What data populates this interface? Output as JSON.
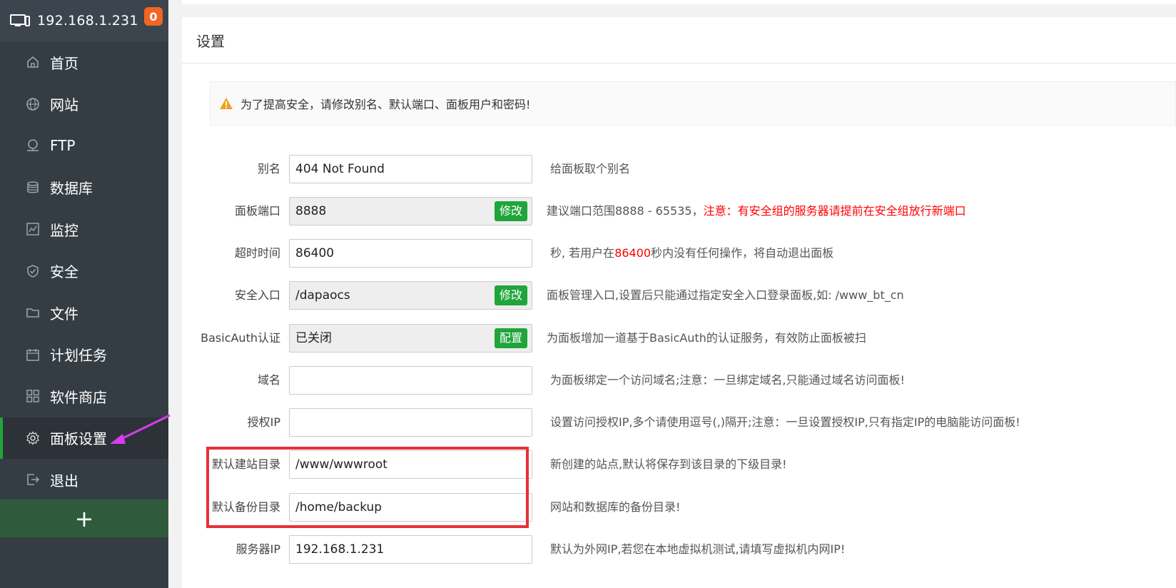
{
  "sidebar": {
    "server_ip": "192.168.1.231",
    "badge_count": "0",
    "items": [
      {
        "label": "首页",
        "icon": "home-icon"
      },
      {
        "label": "网站",
        "icon": "globe-icon"
      },
      {
        "label": "FTP",
        "icon": "ftp-icon"
      },
      {
        "label": "数据库",
        "icon": "database-icon"
      },
      {
        "label": "监控",
        "icon": "monitor-chart-icon"
      },
      {
        "label": "安全",
        "icon": "shield-icon"
      },
      {
        "label": "文件",
        "icon": "folder-icon"
      },
      {
        "label": "计划任务",
        "icon": "calendar-icon"
      },
      {
        "label": "软件商店",
        "icon": "grid-icon"
      },
      {
        "label": "面板设置",
        "icon": "gear-icon",
        "active": true
      },
      {
        "label": "退出",
        "icon": "logout-icon"
      }
    ],
    "add_label": "+"
  },
  "main": {
    "title": "设置",
    "alert": "为了提高安全，请修改别名、默认端口、面板用户和密码!",
    "fields": {
      "alias": {
        "label": "别名",
        "value": "404 Not Found",
        "desc": "给面板取个别名"
      },
      "port": {
        "label": "面板端口",
        "value": "8888",
        "button": "修改",
        "desc": "建议端口范围8888 - 65535，",
        "desc_warn": "注意：有安全组的服务器请提前在安全组放行新端口"
      },
      "timeout": {
        "label": "超时时间",
        "value": "86400",
        "desc_pre": "秒, 若用户在",
        "desc_num": "86400",
        "desc_post": "秒内没有任何操作，将自动退出面板"
      },
      "entry": {
        "label": "安全入口",
        "value": "/dapaocs",
        "button": "修改",
        "desc": "面板管理入口,设置后只能通过指定安全入口登录面板,如: /www_bt_cn"
      },
      "basicauth": {
        "label": "BasicAuth认证",
        "value": "已关闭",
        "button": "配置",
        "desc": "为面板增加一道基于BasicAuth的认证服务，有效防止面板被扫"
      },
      "domain": {
        "label": "域名",
        "value": "",
        "desc": "为面板绑定一个访问域名;注意：一旦绑定域名,只能通过域名访问面板!"
      },
      "auth_ip": {
        "label": "授权IP",
        "value": "",
        "desc": "设置访问授权IP,多个请使用逗号(,)隔开;注意：一旦设置授权IP,只有指定IP的电脑能访问面板!"
      },
      "site_dir": {
        "label": "默认建站目录",
        "value": "/www/wwwroot",
        "desc": "新创建的站点,默认将保存到该目录的下级目录!"
      },
      "backup_dir": {
        "label": "默认备份目录",
        "value": "/home/backup",
        "desc": "网站和数据库的备份目录!"
      },
      "server_ip": {
        "label": "服务器IP",
        "value": "192.168.1.231",
        "desc": "默认为外网IP,若您在本地虚拟机测试,请填写虚拟机内网IP!"
      }
    }
  },
  "colors": {
    "accent": "#20a53a",
    "highlight_box": "#e8303a",
    "arrow": "#d63cf0",
    "badge": "#f26522"
  }
}
